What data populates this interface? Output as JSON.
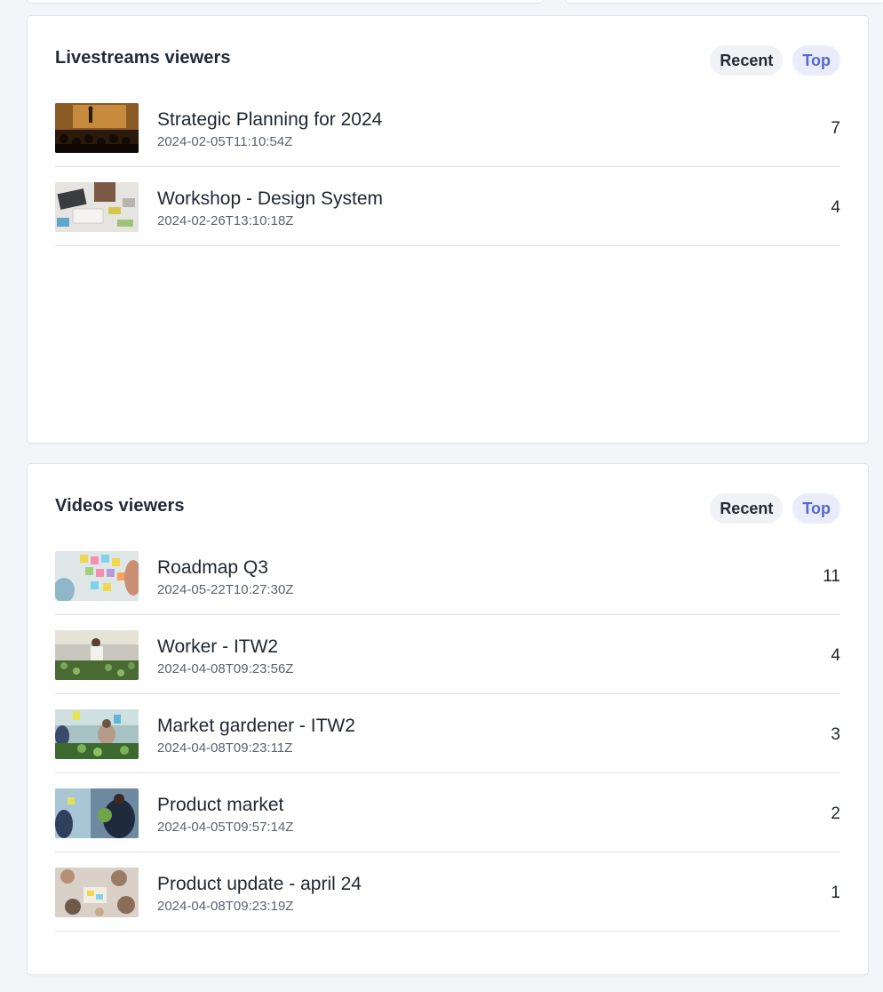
{
  "livestreams": {
    "title": "Livestreams viewers",
    "tabs": {
      "recent": "Recent",
      "top": "Top"
    },
    "items": [
      {
        "title": "Strategic Planning for 2024",
        "date": "2024-02-05T11:10:54Z",
        "count": "7"
      },
      {
        "title": "Workshop - Design System",
        "date": "2024-02-26T13:10:18Z",
        "count": "4"
      }
    ]
  },
  "videos": {
    "title": "Videos viewers",
    "tabs": {
      "recent": "Recent",
      "top": "Top"
    },
    "items": [
      {
        "title": "Roadmap Q3",
        "date": "2024-05-22T10:27:30Z",
        "count": "11"
      },
      {
        "title": "Worker - ITW2",
        "date": "2024-04-08T09:23:56Z",
        "count": "4"
      },
      {
        "title": "Market gardener - ITW2",
        "date": "2024-04-08T09:23:11Z",
        "count": "3"
      },
      {
        "title": "Product market",
        "date": "2024-04-05T09:57:14Z",
        "count": "2"
      },
      {
        "title": "Product update - april 24",
        "date": "2024-04-08T09:23:19Z",
        "count": "1"
      }
    ]
  },
  "colors": {
    "accent": "#5468d4",
    "accent_bg": "#e9ecfb",
    "page_bg": "#f3f5f9"
  }
}
